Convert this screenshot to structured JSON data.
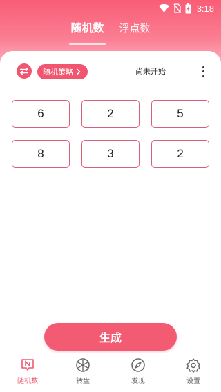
{
  "status_bar": {
    "time": "3:18"
  },
  "tabs": [
    {
      "label": "随机数"
    },
    {
      "label": "浮点数"
    }
  ],
  "controls": {
    "strategy_label": "随机策略",
    "status": "尚未开始"
  },
  "numbers": [
    "6",
    "2",
    "5",
    "8",
    "3",
    "2"
  ],
  "generate_label": "生成",
  "nav": [
    {
      "label": "随机数"
    },
    {
      "label": "转盘"
    },
    {
      "label": "发现"
    },
    {
      "label": "设置"
    }
  ],
  "colors": {
    "accent": "#f05a73"
  }
}
